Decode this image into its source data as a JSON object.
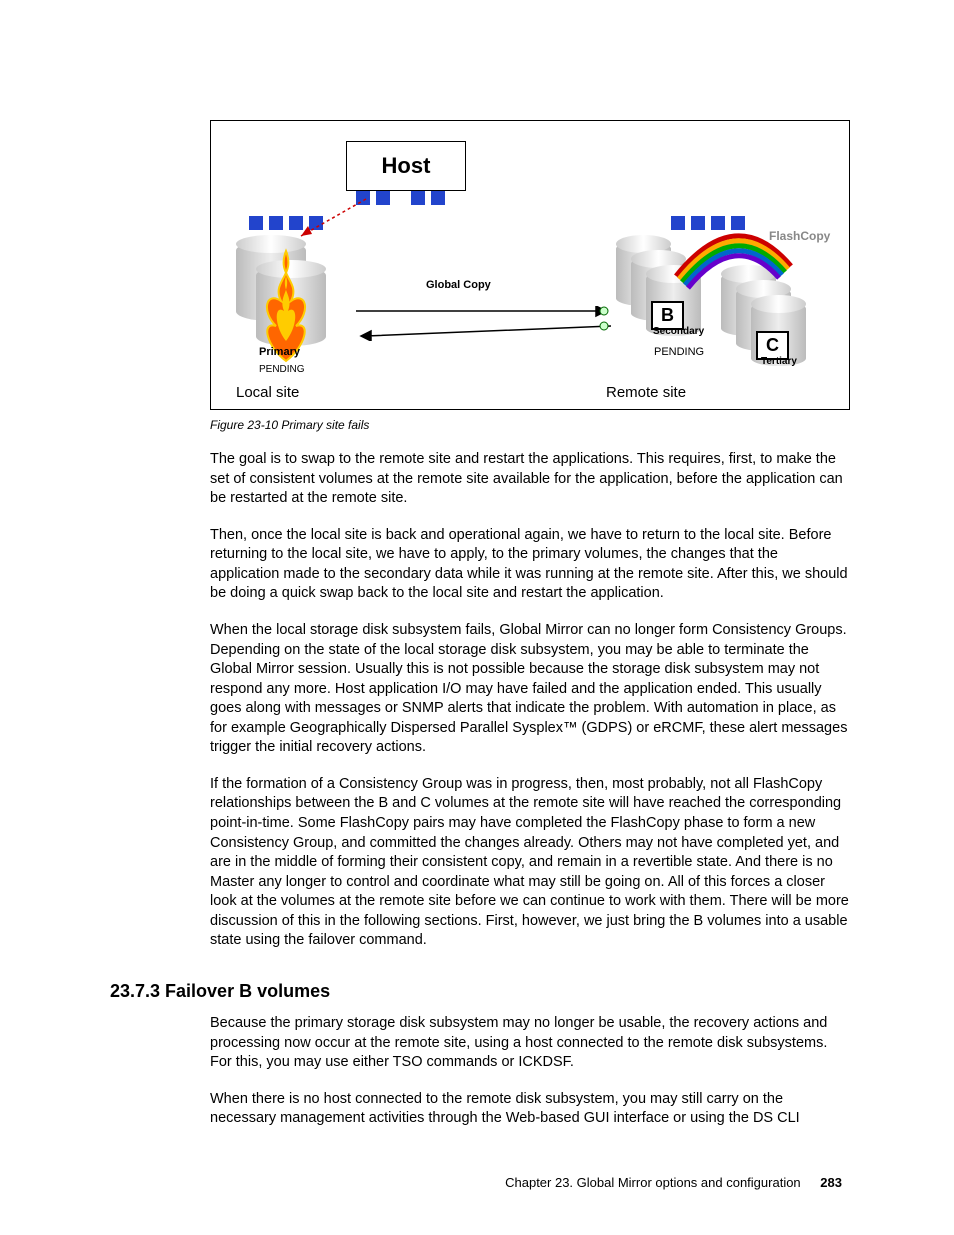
{
  "figure": {
    "host": "Host",
    "global_copy": "Global Copy",
    "flashcopy": "FlashCopy",
    "b_label": "B",
    "c_label": "C",
    "secondary": "Secondary",
    "tertiary": "Tertiary",
    "pending_remote": "PENDING",
    "primary": "Primary",
    "pending_local": "PENDING",
    "local_site": "Local site",
    "remote_site": "Remote site",
    "caption": "Figure 23-10   Primary site fails"
  },
  "paragraphs": {
    "p1": "The goal is to swap to the remote site and restart the applications. This requires, first, to make the set of consistent volumes at the remote site available for the application, before the application can be restarted at the remote site.",
    "p2": "Then, once the local site is back and operational again, we have to return to the local site. Before returning to the local site, we have to apply, to the primary volumes, the changes that the application made to the secondary data while it was running at the remote site. After this, we should be doing a quick swap back to the local site and restart the application.",
    "p3": "When the local storage disk subsystem fails, Global Mirror can no longer form Consistency Groups. Depending on the state of the local storage disk subsystem, you may be able to terminate the Global Mirror session. Usually this is not possible because the storage disk subsystem may not respond any more. Host application I/O may have failed and the application ended. This usually goes along with messages or SNMP alerts that indicate the problem. With automation in place, as for example Geographically Dispersed Parallel Sysplex™ (GDPS) or eRCMF, these alert messages trigger the initial recovery actions.",
    "p4": "If the formation of a Consistency Group was in progress, then, most probably, not all FlashCopy relationships between the B and C volumes at the remote site will have reached the corresponding point-in-time. Some FlashCopy pairs may have completed the FlashCopy phase to form a new Consistency Group, and committed the changes already. Others may not have completed yet, and are in the middle of forming their consistent copy, and remain in a revertible state. And there is no Master any longer to control and coordinate what may still be going on. All of this forces a closer look at the volumes at the remote site before we can continue to work with them. There will be more discussion of this in the following sections. First, however, we just bring the B volumes into a usable state using the failover command.",
    "p5": "Because the primary storage disk subsystem may no longer be usable, the recovery actions and processing now occur at the remote site, using a host connected to the remote disk subsystems. For this, you may use either TSO commands or ICKDSF.",
    "p6": "When there is no host connected to the remote disk subsystem, you may still carry on the necessary management activities through the Web-based GUI interface or using the DS CLI"
  },
  "section_heading": "23.7.3  Failover B volumes",
  "footer": {
    "chapter": "Chapter 23. Global Mirror options and configuration",
    "page": "283"
  }
}
